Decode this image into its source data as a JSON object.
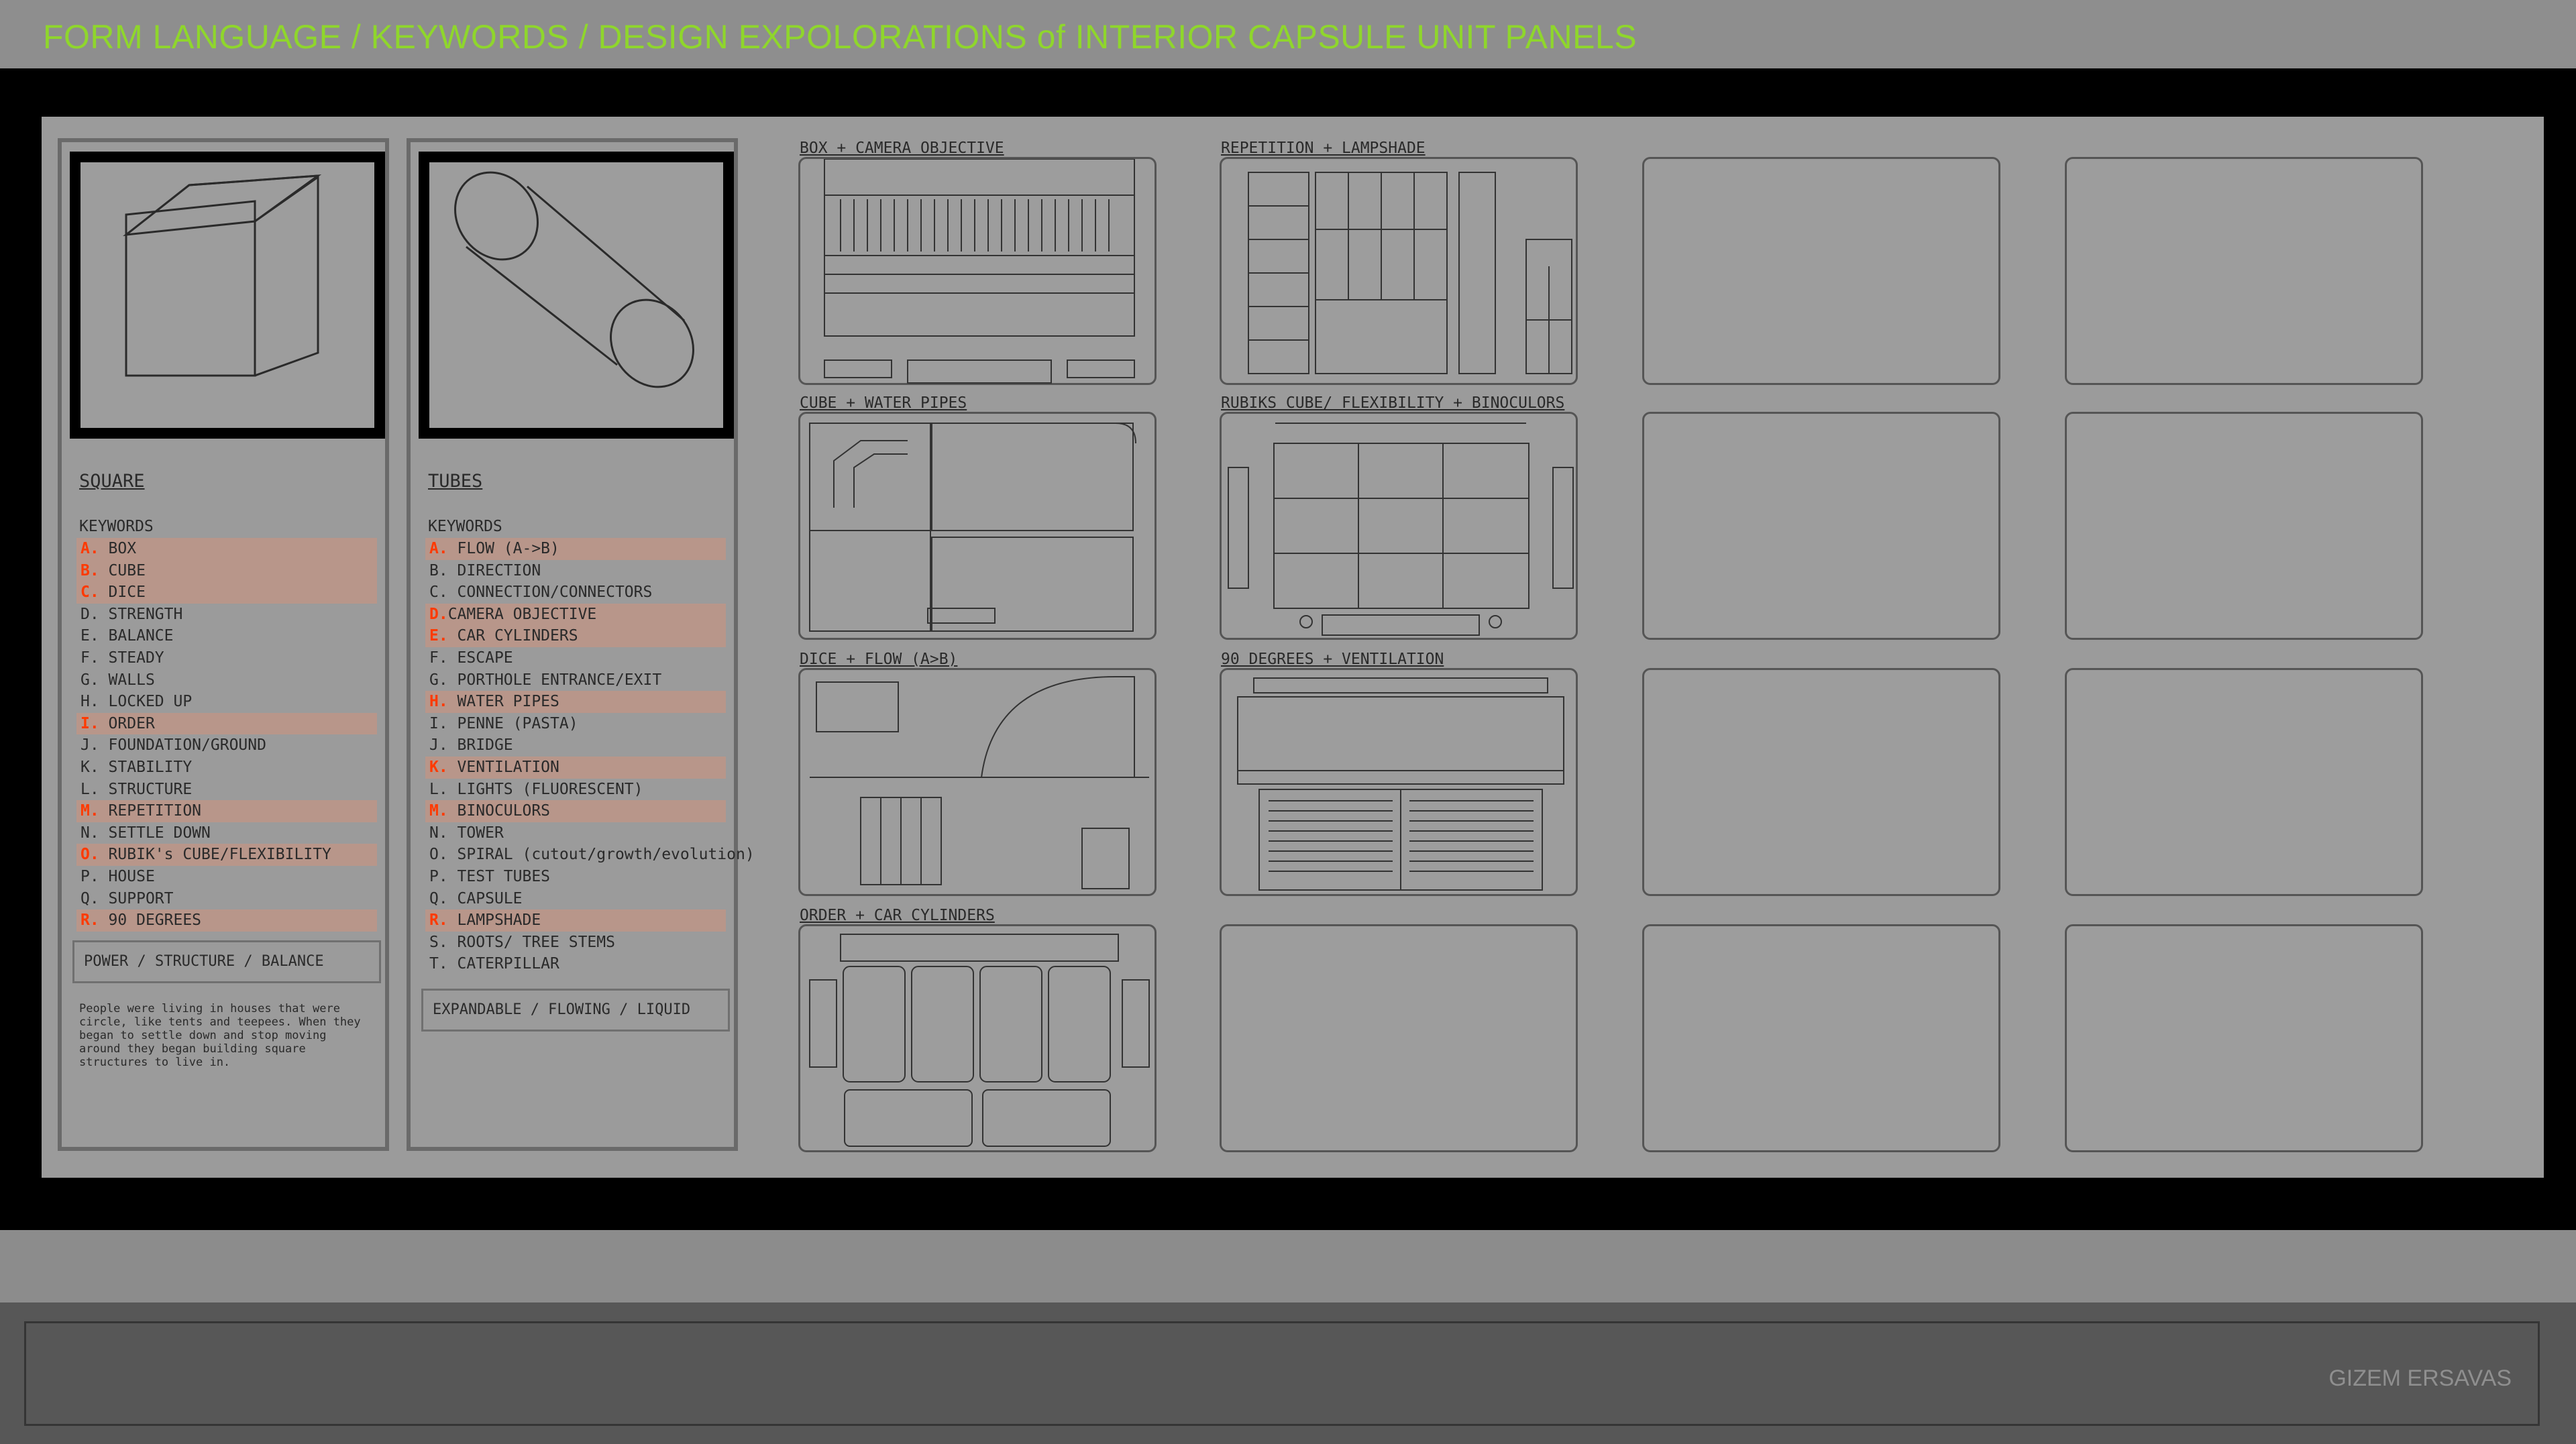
{
  "header": {
    "title": "FORM LANGUAGE / KEYWORDS / DESIGN EXPOLORATIONS of INTERIOR CAPSULE UNIT PANELS"
  },
  "colors": {
    "title": "#8fd62c",
    "highlight": "#b8968a",
    "highlight_letter": "#ff3a00"
  },
  "columns": [
    {
      "icon": "cube-icon",
      "heading": "SQUARE",
      "keywords_label": "KEYWORDS",
      "keywords": [
        {
          "letter": "A.",
          "text": " BOX",
          "highlighted": true
        },
        {
          "letter": "B.",
          "text": " CUBE",
          "highlighted": true
        },
        {
          "letter": "C.",
          "text": " DICE",
          "highlighted": true
        },
        {
          "letter": "D.",
          "text": " STRENGTH",
          "highlighted": false
        },
        {
          "letter": "E.",
          "text": " BALANCE",
          "highlighted": false
        },
        {
          "letter": "F.",
          "text": " STEADY",
          "highlighted": false
        },
        {
          "letter": "G.",
          "text": " WALLS",
          "highlighted": false
        },
        {
          "letter": "H.",
          "text": " LOCKED UP",
          "highlighted": false
        },
        {
          "letter": "I.",
          "text": " ORDER",
          "highlighted": true
        },
        {
          "letter": "J.",
          "text": " FOUNDATION/GROUND",
          "highlighted": false
        },
        {
          "letter": "K.",
          "text": " STABILITY",
          "highlighted": false
        },
        {
          "letter": "L.",
          "text": " STRUCTURE",
          "highlighted": false
        },
        {
          "letter": "M.",
          "text": " REPETITION",
          "highlighted": true
        },
        {
          "letter": "N.",
          "text": " SETTLE DOWN",
          "highlighted": false
        },
        {
          "letter": "O.",
          "text": " RUBIK's CUBE/FLEXIBILITY",
          "highlighted": true
        },
        {
          "letter": "P.",
          "text": " HOUSE",
          "highlighted": false
        },
        {
          "letter": "Q.",
          "text": " SUPPORT",
          "highlighted": false
        },
        {
          "letter": "R.",
          "text": " 90 DEGREES",
          "highlighted": true
        }
      ],
      "summary": "POWER / STRUCTURE / BALANCE",
      "note": "People were living in houses that were circle, like tents and teepees. When they began to settle down and stop moving around they began building square structures to live in."
    },
    {
      "icon": "cylinder-icon",
      "heading": "TUBES",
      "keywords_label": "KEYWORDS",
      "keywords": [
        {
          "letter": "A.",
          "text": " FLOW (A->B)",
          "highlighted": true
        },
        {
          "letter": "B.",
          "text": " DIRECTION",
          "highlighted": false
        },
        {
          "letter": "C.",
          "text": " CONNECTION/CONNECTORS",
          "highlighted": false
        },
        {
          "letter": "D.",
          "text": "CAMERA OBJECTIVE",
          "highlighted": true
        },
        {
          "letter": "E.",
          "text": " CAR CYLINDERS",
          "highlighted": true
        },
        {
          "letter": "F.",
          "text": " ESCAPE",
          "highlighted": false
        },
        {
          "letter": "G.",
          "text": " PORTHOLE ENTRANCE/EXIT",
          "highlighted": false
        },
        {
          "letter": "H.",
          "text": " WATER PIPES",
          "highlighted": true
        },
        {
          "letter": "I.",
          "text": " PENNE (PASTA)",
          "highlighted": false
        },
        {
          "letter": "J.",
          "text": " BRIDGE",
          "highlighted": false
        },
        {
          "letter": "K.",
          "text": " VENTILATION",
          "highlighted": true
        },
        {
          "letter": "L.",
          "text": " LIGHTS (FLUORESCENT)",
          "highlighted": false
        },
        {
          "letter": "M.",
          "text": " BINOCULORS",
          "highlighted": true
        },
        {
          "letter": "N.",
          "text": " TOWER",
          "highlighted": false
        },
        {
          "letter": "O.",
          "text": " SPIRAL (cutout/growth/evolution)",
          "highlighted": false
        },
        {
          "letter": "P.",
          "text": " TEST TUBES",
          "highlighted": false
        },
        {
          "letter": "Q.",
          "text": " CAPSULE",
          "highlighted": false
        },
        {
          "letter": "R.",
          "text": " LAMPSHADE",
          "highlighted": true
        },
        {
          "letter": "S.",
          "text": " ROOTS/ TREE STEMS",
          "highlighted": false
        },
        {
          "letter": "T.",
          "text": " CATERPILLAR",
          "highlighted": false
        }
      ],
      "summary": "EXPANDABLE / FLOWING / LIQUID"
    }
  ],
  "panels": {
    "labels": [
      "BOX + CAMERA OBJECTIVE",
      "REPETITION + LAMPSHADE",
      "CUBE + WATER PIPES",
      "RUBIKS CUBE/ FLEXIBILITY + BINOCULORS",
      "DICE + FLOW (A>B)",
      "90 DEGREES + VENTILATION",
      "ORDER + CAR CYLINDERS"
    ]
  },
  "footer": {
    "author": "GIZEM ERSAVAS"
  }
}
